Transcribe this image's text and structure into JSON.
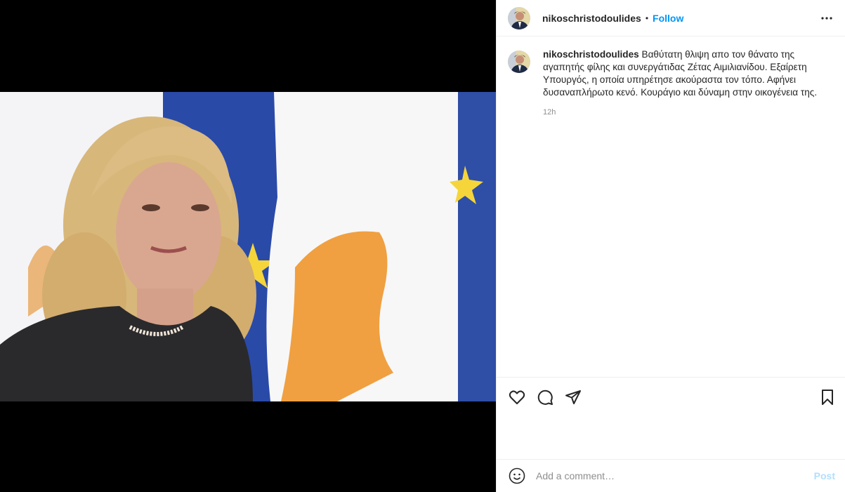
{
  "post": {
    "username": "nikoschristodoulides",
    "follow_label": "Follow",
    "separator": "•",
    "caption": "Βαθύτατη θλιψη απο τον θάνατο της αγαπητής φίλης και συνεργάτιδας Ζέτας Αιμιλιανίδου. Εξαίρετη Υπουργός, η οποία υπηρέτησε ακούραστα τον τόπο. Αφήνει δυσαναπλήρωτο κενό. Κουράγιο και δύναμη στην οικογένεια της.",
    "time_ago": "12h"
  },
  "comment": {
    "placeholder": "Add a comment…",
    "post_label": "Post"
  },
  "icons": {
    "more": "more-options-icon",
    "like": "heart-icon",
    "comment": "comment-icon",
    "share": "share-icon",
    "save": "bookmark-icon",
    "emoji": "emoji-icon"
  },
  "colors": {
    "accent": "#0095f6",
    "post_disabled": "#b2dffc",
    "muted": "#8e8e8e"
  }
}
